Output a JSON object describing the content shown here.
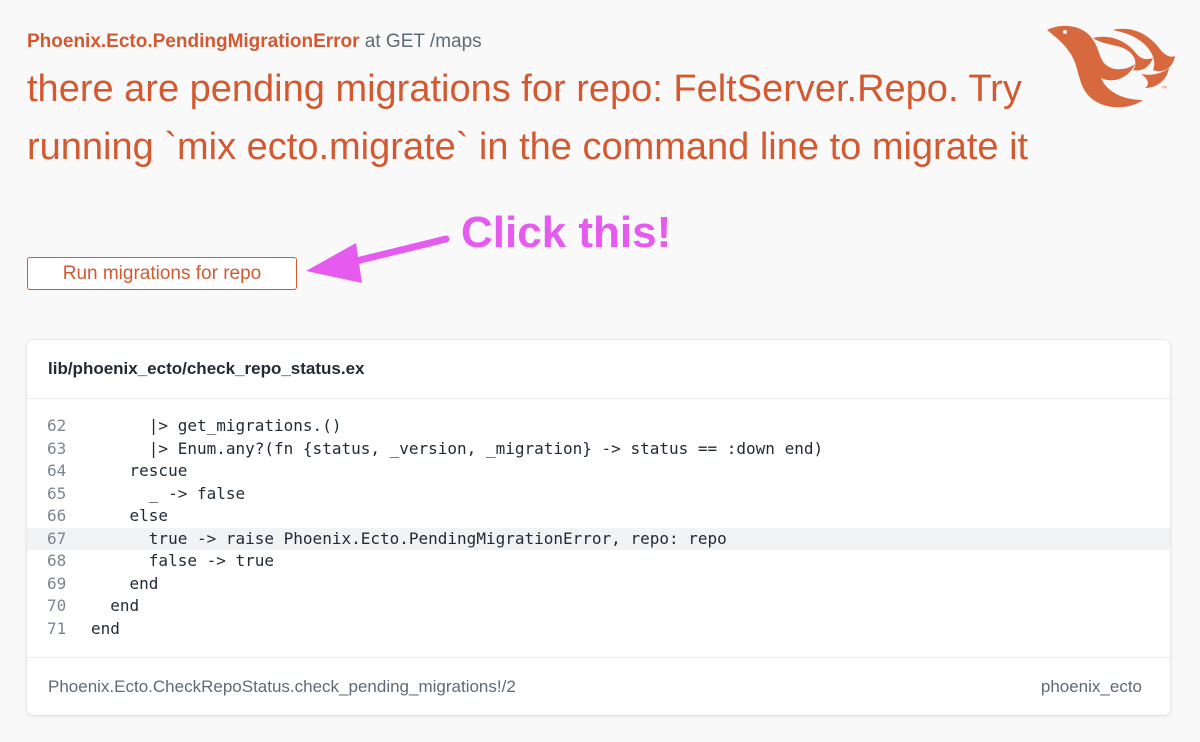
{
  "error": {
    "name": "Phoenix.Ecto.PendingMigrationError",
    "request": " at GET /maps",
    "message": "there are pending migrations for repo: FeltServer.Repo. Try running `mix ecto.migrate` in the command line to migrate it"
  },
  "actions": {
    "run_migrations_label": "Run migrations for repo"
  },
  "annotation": {
    "text": "Click this!",
    "color": "#e75af0"
  },
  "colors": {
    "accent": "#d25930",
    "annotation": "#e75af0",
    "background": "#f9f9fa",
    "highlight_line": "#f2f3f5"
  },
  "logo": {
    "icon": "phoenix-logo-icon"
  },
  "source": {
    "file": "lib/phoenix_ecto/check_repo_status.ex",
    "highlighted_line": 67,
    "lines": [
      {
        "number": "62",
        "code": "      |> get_migrations.()"
      },
      {
        "number": "63",
        "code": "      |> Enum.any?(fn {status, _version, _migration} -> status == :down end)"
      },
      {
        "number": "64",
        "code": "    rescue"
      },
      {
        "number": "65",
        "code": "      _ -> false"
      },
      {
        "number": "66",
        "code": "    else"
      },
      {
        "number": "67",
        "code": "      true -> raise Phoenix.Ecto.PendingMigrationError, repo: repo"
      },
      {
        "number": "68",
        "code": "      false -> true"
      },
      {
        "number": "69",
        "code": "    end"
      },
      {
        "number": "70",
        "code": "  end"
      },
      {
        "number": "71",
        "code": "end"
      }
    ],
    "function": "Phoenix.Ecto.CheckRepoStatus.check_pending_migrations!/2",
    "app": "phoenix_ecto"
  }
}
